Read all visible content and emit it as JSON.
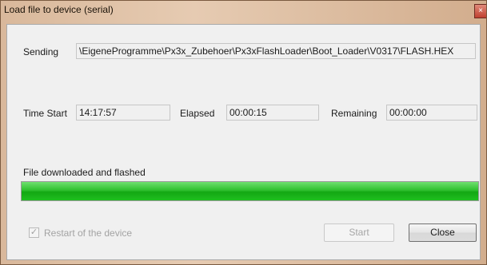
{
  "window": {
    "title": "Load file to device (serial)",
    "close_glyph": "×"
  },
  "sending": {
    "label": "Sending",
    "value": "\\EigeneProgramme\\Px3x_Zubehoer\\Px3xFlashLoader\\Boot_Loader\\V0317\\FLASH.HEX"
  },
  "timing": {
    "start_label": "Time Start",
    "start_value": "14:17:57",
    "elapsed_label": "Elapsed",
    "elapsed_value": "00:00:15",
    "remaining_label": "Remaining",
    "remaining_value": "00:00:00"
  },
  "status": {
    "text": "File downloaded and flashed",
    "progress_percent": 100,
    "progress_color": "#1fbf1f"
  },
  "options": {
    "restart_label": "Restart of the device",
    "restart_checked": true,
    "check_glyph": "✓"
  },
  "buttons": {
    "start_label": "Start",
    "close_label": "Close"
  }
}
